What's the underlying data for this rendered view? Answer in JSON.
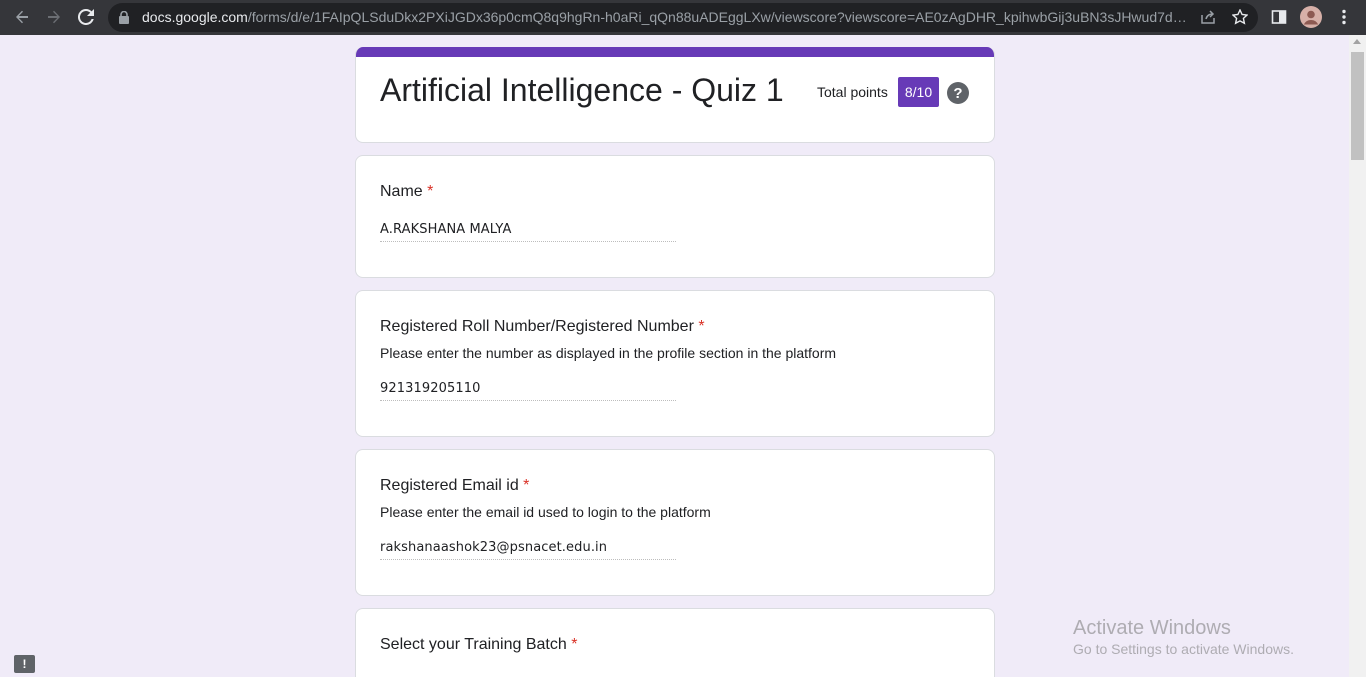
{
  "browser": {
    "url_host": "docs.google.com",
    "url_path": "/forms/d/e/1FAIpQLSduDkx2PXiJGDx36p0cmQ8q9hgRn-h0aRi_qQn88uADEggLXw/viewscore?viewscore=AE0zAgDHR_kpihwbGij3uBN3sJHwud7dyMX..."
  },
  "form": {
    "title": "Artificial Intelligence - Quiz 1",
    "points_label": "Total points",
    "points_value": "8/10",
    "help_symbol": "?"
  },
  "questions": [
    {
      "title": "Name",
      "required": "*",
      "description": "",
      "answer": "A.RAKSHANA MALYA"
    },
    {
      "title": "Registered Roll Number/Registered Number",
      "required": "*",
      "description": "Please enter the number as displayed in the profile section in the platform",
      "answer": "921319205110"
    },
    {
      "title": "Registered Email id ",
      "required": "*",
      "description": "Please enter the email id used to login to the platform",
      "answer": "rakshanaashok23@psnacet.edu.in"
    },
    {
      "title": "Select your Training Batch",
      "required": "*"
    }
  ],
  "watermark": {
    "title": "Activate Windows",
    "subtitle": "Go to Settings to activate Windows."
  },
  "feedback_symbol": "!",
  "colors": {
    "accent": "#673ab7",
    "background": "#f0ebf8",
    "required": "#d93025"
  }
}
